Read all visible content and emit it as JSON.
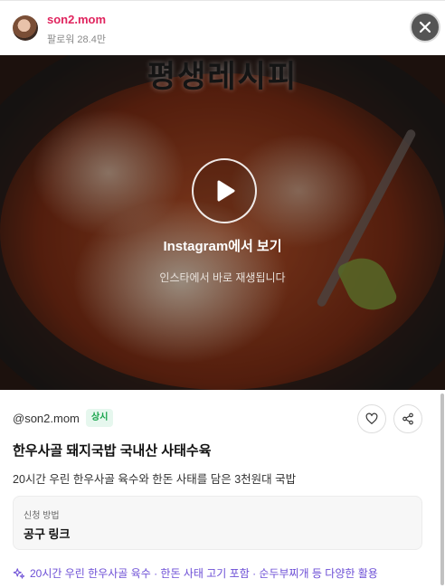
{
  "header": {
    "username": "son2.mom",
    "followers": "팔로워 28.4만"
  },
  "video": {
    "overlay_title": "평생레시피",
    "play_label": "Instagram에서 보기",
    "play_sub": "인스타에서 바로 재생됩니다"
  },
  "product": {
    "handle": "@son2.mom",
    "badge": "상시",
    "title": "한우사골 돼지국밥 국내산 사태수육",
    "description": "20시간 우린 한우사골 육수와 한돈 사태를 담은 3천원대 국밥",
    "method_label": "신청 방법",
    "method_value": "공구 링크",
    "feature": "20시간 우린 한우사골 육수 · 한돈 사태 고기 포함 · 순두부찌개 등 다양한 활용"
  },
  "icons": {
    "close": "close-icon",
    "play": "play-icon",
    "heart": "heart-icon",
    "share": "share-icon",
    "sparkle": "sparkle-icon"
  },
  "colors": {
    "username": "#e0245e",
    "badge_bg": "#e6f7ee",
    "badge_text": "#16a34a",
    "feature_text": "#6d4fd6"
  }
}
